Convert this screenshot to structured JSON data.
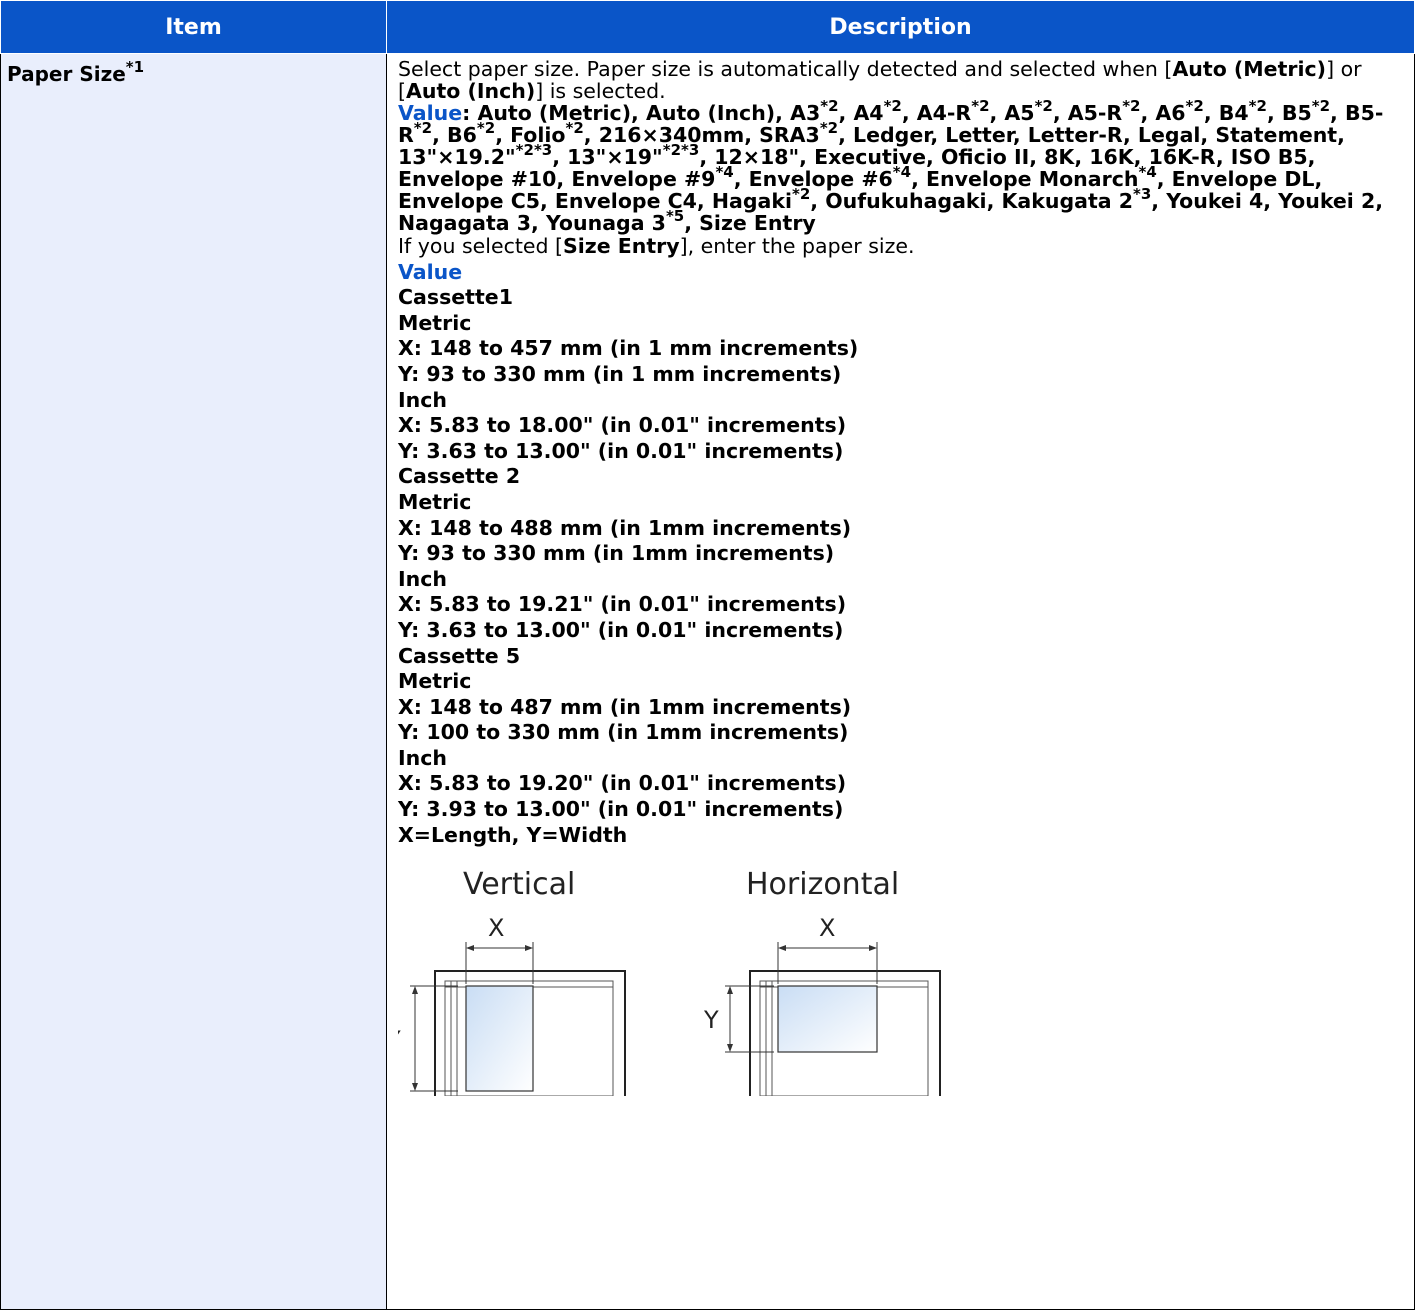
{
  "header": {
    "item": "Item",
    "description": "Description"
  },
  "row": {
    "item_label": "Paper Size",
    "item_sup": "*1",
    "intro": {
      "t1": "Select paper size. Paper size is automatically detected and selected when [",
      "b1": "Auto (Metric)",
      "t2": "] or [",
      "b2": "Auto (Inch)",
      "t3": "] is selected."
    },
    "value_label": "Value",
    "value_colon": ":",
    "value_list": [
      {
        "t": " Auto (Metric), Auto (Inch), A3"
      },
      {
        "s": "*2"
      },
      {
        "t": ", A4"
      },
      {
        "s": "*2"
      },
      {
        "t": ", A4-R"
      },
      {
        "s": "*2"
      },
      {
        "t": ", A5"
      },
      {
        "s": "*2"
      },
      {
        "t": ", A5-R"
      },
      {
        "s": "*2"
      },
      {
        "t": ", A6"
      },
      {
        "s": "*2"
      },
      {
        "t": ", B4"
      },
      {
        "s": "*2"
      },
      {
        "t": ", B5"
      },
      {
        "s": "*2"
      },
      {
        "t": ", B5-R"
      },
      {
        "s": "*2"
      },
      {
        "t": ", B6"
      },
      {
        "s": "*2"
      },
      {
        "t": ", Folio"
      },
      {
        "s": "*2"
      },
      {
        "t": ", 216×340mm, SRA3"
      },
      {
        "s": "*2"
      },
      {
        "t": ", Ledger, Letter, Letter-R, Legal, Statement, 13\"×19.2\""
      },
      {
        "s": "*2*3"
      },
      {
        "t": ", 13\"×19\""
      },
      {
        "s": "*2*3"
      },
      {
        "t": ", 12×18\", Executive, Oficio II, 8K, 16K, 16K-R, ISO B5, Envelope #10, Envelope #9"
      },
      {
        "s": "*4"
      },
      {
        "t": ", Envelope #6"
      },
      {
        "s": "*4"
      },
      {
        "t": ", Envelope Monarch"
      },
      {
        "s": "*4"
      },
      {
        "t": ", Envelope DL, Envelope C5, Envelope C4, Hagaki"
      },
      {
        "s": "*2"
      },
      {
        "t": ", Oufukuhagaki, Kakugata 2"
      },
      {
        "s": "*3"
      },
      {
        "t": ", Youkei 4, Youkei 2, Nagagata 3, Younaga 3"
      },
      {
        "s": "*5"
      },
      {
        "t": ", Size Entry"
      }
    ],
    "size_entry_note": {
      "t1": "If you selected [",
      "b1": "Size Entry",
      "t2": "], enter the paper size."
    },
    "value_label2": "Value",
    "cassettes": [
      {
        "name": "Cassette1",
        "metric_label": "Metric",
        "metric_x": "X: 148 to 457 mm (in 1 mm increments)",
        "metric_y": "Y: 93 to 330 mm (in 1 mm increments)",
        "inch_label": "Inch",
        "inch_x": "X: 5.83 to 18.00\" (in 0.01\" increments)",
        "inch_y": "Y: 3.63 to 13.00\" (in 0.01\" increments)"
      },
      {
        "name": "Cassette 2",
        "metric_label": "Metric",
        "metric_x": "X: 148 to 488 mm (in 1mm increments)",
        "metric_y": "Y: 93 to 330 mm (in 1mm increments)",
        "inch_label": "Inch",
        "inch_x": "X: 5.83 to 19.21\" (in 0.01\" increments)",
        "inch_y": "Y: 3.63 to 13.00\" (in 0.01\" increments)"
      },
      {
        "name": "Cassette 5",
        "metric_label": "Metric",
        "metric_x": "X: 148 to 487 mm (in 1mm increments)",
        "metric_y": "Y: 100 to 330 mm (in 1mm increments)",
        "inch_label": "Inch",
        "inch_x": "X: 5.83 to 19.20\" (in 0.01\" increments)",
        "inch_y": "Y: 3.93 to 13.00\" (in 0.01\" increments)"
      }
    ],
    "xy_note": "X=Length, Y=Width",
    "figure": {
      "vertical_title": "Vertical",
      "horizontal_title": "Horizontal",
      "x_label": "X",
      "y_label": "Y"
    }
  }
}
